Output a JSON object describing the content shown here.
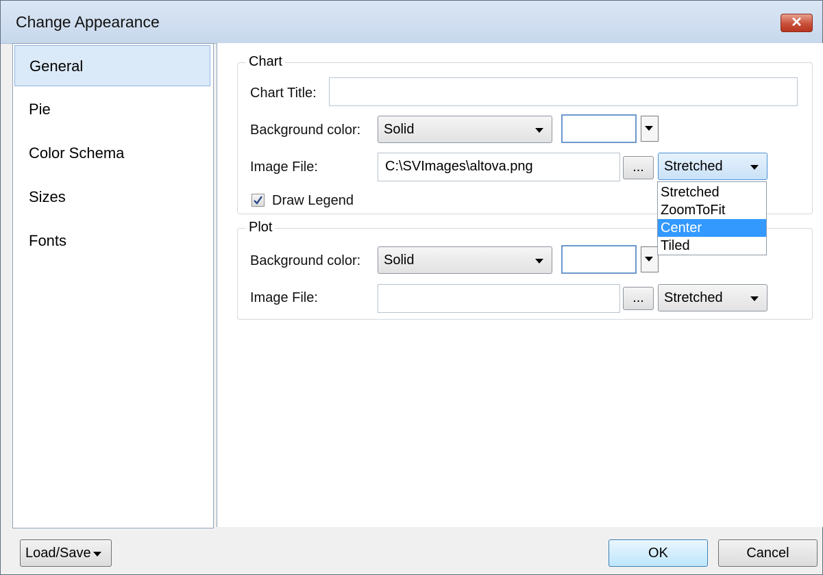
{
  "dialog": {
    "title": "Change Appearance",
    "close_icon": "close-x"
  },
  "sidebar": {
    "items": [
      {
        "label": "General",
        "selected": true
      },
      {
        "label": "Pie"
      },
      {
        "label": "Color Schema"
      },
      {
        "label": "Sizes"
      },
      {
        "label": "Fonts"
      }
    ]
  },
  "chart_group": {
    "legend": "Chart",
    "chart_title_label": "Chart Title:",
    "chart_title_value": "",
    "bg_color_label": "Background color:",
    "bg_color_value": "Solid",
    "bg_color_swatch": "#ffffff",
    "image_file_label": "Image File:",
    "image_file_value": "C:\\SVImages\\altova.png",
    "browse_label": "...",
    "image_mode_value": "Stretched",
    "draw_legend_label": "Draw Legend",
    "draw_legend_checked": true
  },
  "image_mode_dropdown": {
    "options": [
      "Stretched",
      "ZoomToFit",
      "Center",
      "Tiled"
    ],
    "highlighted": "Center"
  },
  "plot_group": {
    "legend": "Plot",
    "bg_color_label": "Background color:",
    "bg_color_value": "Solid",
    "bg_color_swatch": "#ffffff",
    "image_file_label": "Image File:",
    "image_file_value": "",
    "browse_label": "...",
    "image_mode_value": "Stretched"
  },
  "footer": {
    "load_save_label": "Load/Save",
    "ok_label": "OK",
    "cancel_label": "Cancel"
  },
  "colors": {
    "selection_highlight": "#3399ff",
    "sidebar_selected": "#dbeaf9",
    "close_button": "#c8503a"
  }
}
